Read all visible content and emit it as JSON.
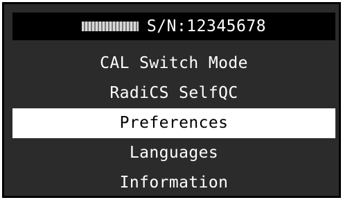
{
  "header": {
    "model_icon": "model-name-blurred",
    "serial": "S/N:12345678"
  },
  "menu": {
    "items": [
      {
        "label": "CAL Switch Mode"
      },
      {
        "label": "RadiCS SelfQC"
      },
      {
        "label": "Preferences",
        "selected": true
      },
      {
        "label": "Languages"
      },
      {
        "label": "Information"
      }
    ]
  },
  "colors": {
    "background": "#2b2b2b",
    "header_bg": "#000000",
    "selected_bg": "#ffffff",
    "text": "#ffffff",
    "selected_text": "#000000"
  }
}
